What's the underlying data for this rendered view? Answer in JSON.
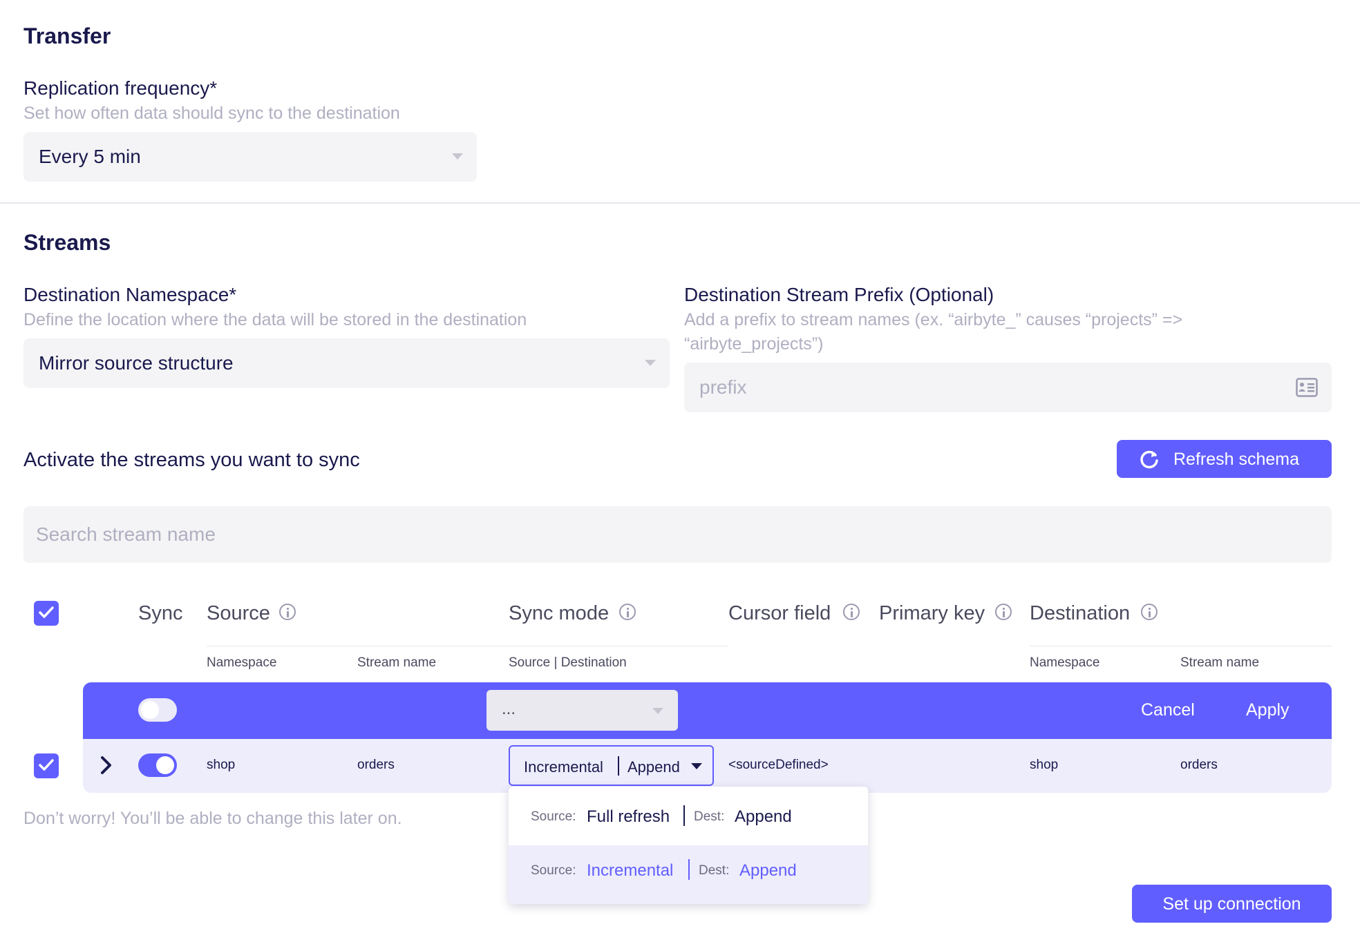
{
  "transfer": {
    "title": "Transfer",
    "frequency_label": "Replication frequency*",
    "frequency_desc": "Set how often data should sync to the destination",
    "frequency_value": "Every 5 min"
  },
  "streams": {
    "title": "Streams",
    "namespace_label": "Destination Namespace*",
    "namespace_desc": "Define the location where the data will be stored in the destination",
    "namespace_value": "Mirror source structure",
    "prefix_label": "Destination Stream Prefix (Optional)",
    "prefix_desc_line1": "Add a prefix to stream names (ex. “airbyte_” causes “projects” =>",
    "prefix_desc_line2": "“airbyte_projects”)",
    "prefix_placeholder": "prefix",
    "activate_label": "Activate the streams you want to sync",
    "refresh_label": "Refresh schema",
    "search_placeholder": "Search stream name"
  },
  "table": {
    "headers": {
      "sync": "Sync",
      "source": "Source",
      "sync_mode": "Sync mode",
      "cursor_field": "Cursor field",
      "primary_key": "Primary key",
      "destination": "Destination"
    },
    "subheaders": {
      "namespace": "Namespace",
      "stream_name": "Stream name",
      "source_destination": "Source | Destination",
      "dest_namespace": "Namespace",
      "dest_stream_name": "Stream name"
    },
    "bulk_row": {
      "mode_value": "...",
      "cancel": "Cancel",
      "apply": "Apply"
    },
    "rows": [
      {
        "namespace": "shop",
        "stream_name": "orders",
        "mode_source": "Incremental",
        "mode_dest": "Append",
        "cursor": "<sourceDefined>",
        "dest_namespace": "shop",
        "dest_stream_name": "orders"
      }
    ]
  },
  "dropdown": {
    "options": [
      {
        "source_label": "Source:",
        "source_value": "Full refresh",
        "dest_label": "Dest:",
        "dest_value": "Append",
        "selected": false
      },
      {
        "source_label": "Source:",
        "source_value": "Incremental",
        "dest_label": "Dest:",
        "dest_value": "Append",
        "selected": true
      }
    ]
  },
  "footer": {
    "note": "Don’t worry! You’ll be able to change this later on.",
    "setup_label": "Set up connection"
  },
  "colors": {
    "accent": "#615eff",
    "text_dark": "#1a194d",
    "text_muted": "#afafc1",
    "field_bg": "#f4f4f6",
    "row_bg": "#eeedfc"
  }
}
